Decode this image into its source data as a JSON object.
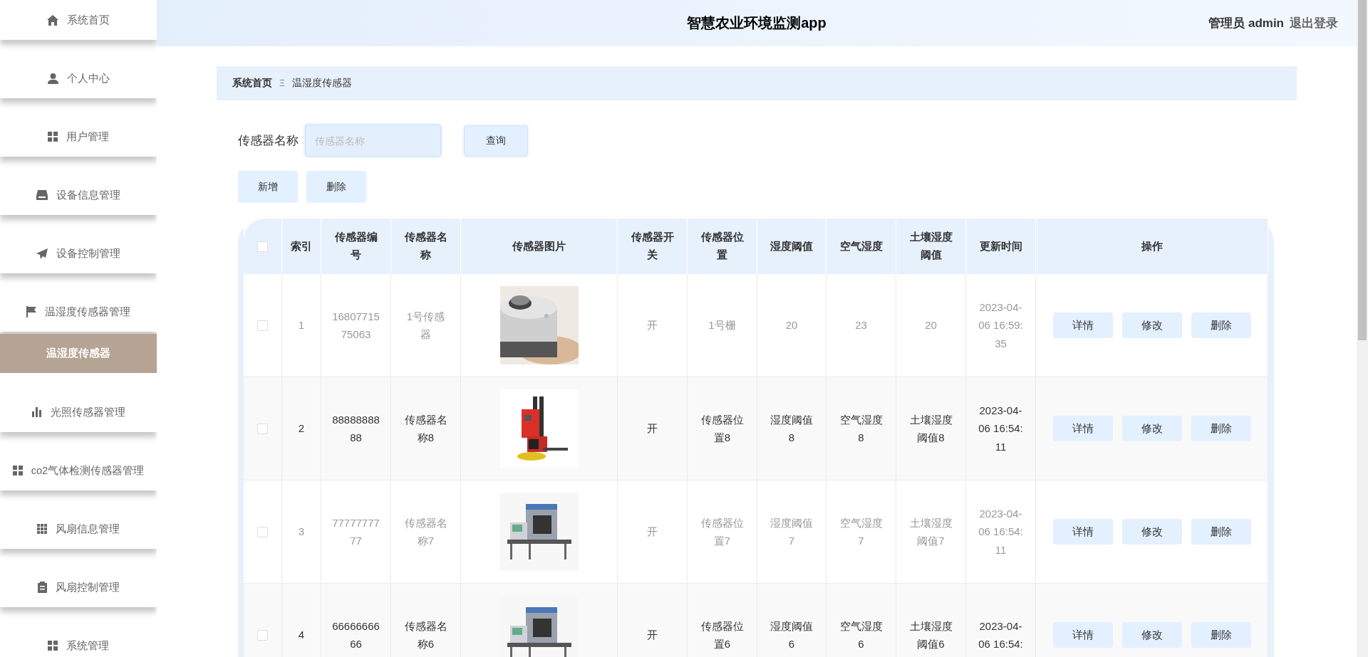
{
  "sidebar": {
    "items": [
      {
        "label": "系统首页",
        "selected": false
      },
      {
        "label": "个人中心",
        "selected": false
      },
      {
        "label": "用户管理",
        "selected": false
      },
      {
        "label": "设备信息管理",
        "selected": false
      },
      {
        "label": "设备控制管理",
        "selected": false
      },
      {
        "label": "温湿度传感器管理",
        "selected": false,
        "children": [
          {
            "label": "温湿度传感器",
            "selected": true
          }
        ]
      },
      {
        "label": "光照传感器管理",
        "selected": false
      },
      {
        "label": "co2气体检测传感器管理",
        "selected": false
      },
      {
        "label": "风扇信息管理",
        "selected": false
      },
      {
        "label": "风扇控制管理",
        "selected": false
      },
      {
        "label": "系统管理",
        "selected": false
      }
    ]
  },
  "header": {
    "title": "智慧农业环境监测app",
    "user": "管理员 admin",
    "logout": "退出登录"
  },
  "breadcrumb": [
    "系统首页",
    "Ξ",
    "温湿度传感器"
  ],
  "search": {
    "label": "传感器名称",
    "placeholder": "传感器名称",
    "button": "查询"
  },
  "toolbar": [
    "新增",
    "删除"
  ],
  "table": {
    "select_all": {
      "checked": false
    },
    "columns": [
      "索引",
      "传感器编号",
      "传感器名称",
      "传感器图片",
      "传感器开关",
      "传感器位置",
      "湿度阈值",
      "空气湿度",
      "土壤湿度阈值",
      "更新时间",
      "操作"
    ],
    "rows": [
      {
        "checked": false,
        "cells": [
          "1",
          "1680771575063",
          "1号传感器",
          {
            "kind": "picture"
          },
          "开",
          "1号栅",
          "20",
          "23",
          "20",
          "2023-04-06 16:59:35"
        ],
        "actions": [
          "详情",
          "修改",
          "删除"
        ]
      },
      {
        "checked": false,
        "cells": [
          "2",
          "8888888888",
          "传感器名称8",
          {
            "kind": "picture"
          },
          "开",
          "传感器位置8",
          "湿度阈值8",
          "空气湿度8",
          "土壤湿度阈值8",
          "2023-04-06 16:54:11"
        ],
        "actions": [
          "详情",
          "修改",
          "删除"
        ]
      },
      {
        "checked": false,
        "cells": [
          "3",
          "7777777777",
          "传感器名称7",
          {
            "kind": "picture"
          },
          "开",
          "传感器位置7",
          "湿度阈值7",
          "空气湿度7",
          "土壤湿度阈值7",
          "2023-04-06 16:54:11"
        ],
        "actions": [
          "详情",
          "修改",
          "删除"
        ]
      },
      {
        "checked": false,
        "cells": [
          "4",
          "6666666666",
          "传感器名称6",
          {
            "kind": "picture"
          },
          "开",
          "传感器位置6",
          "湿度阈值6",
          "空气湿度6",
          "土壤湿度阈值6",
          "2023-04-06 16:54:"
        ],
        "actions": [
          "详情",
          "修改",
          "删除"
        ]
      }
    ]
  }
}
